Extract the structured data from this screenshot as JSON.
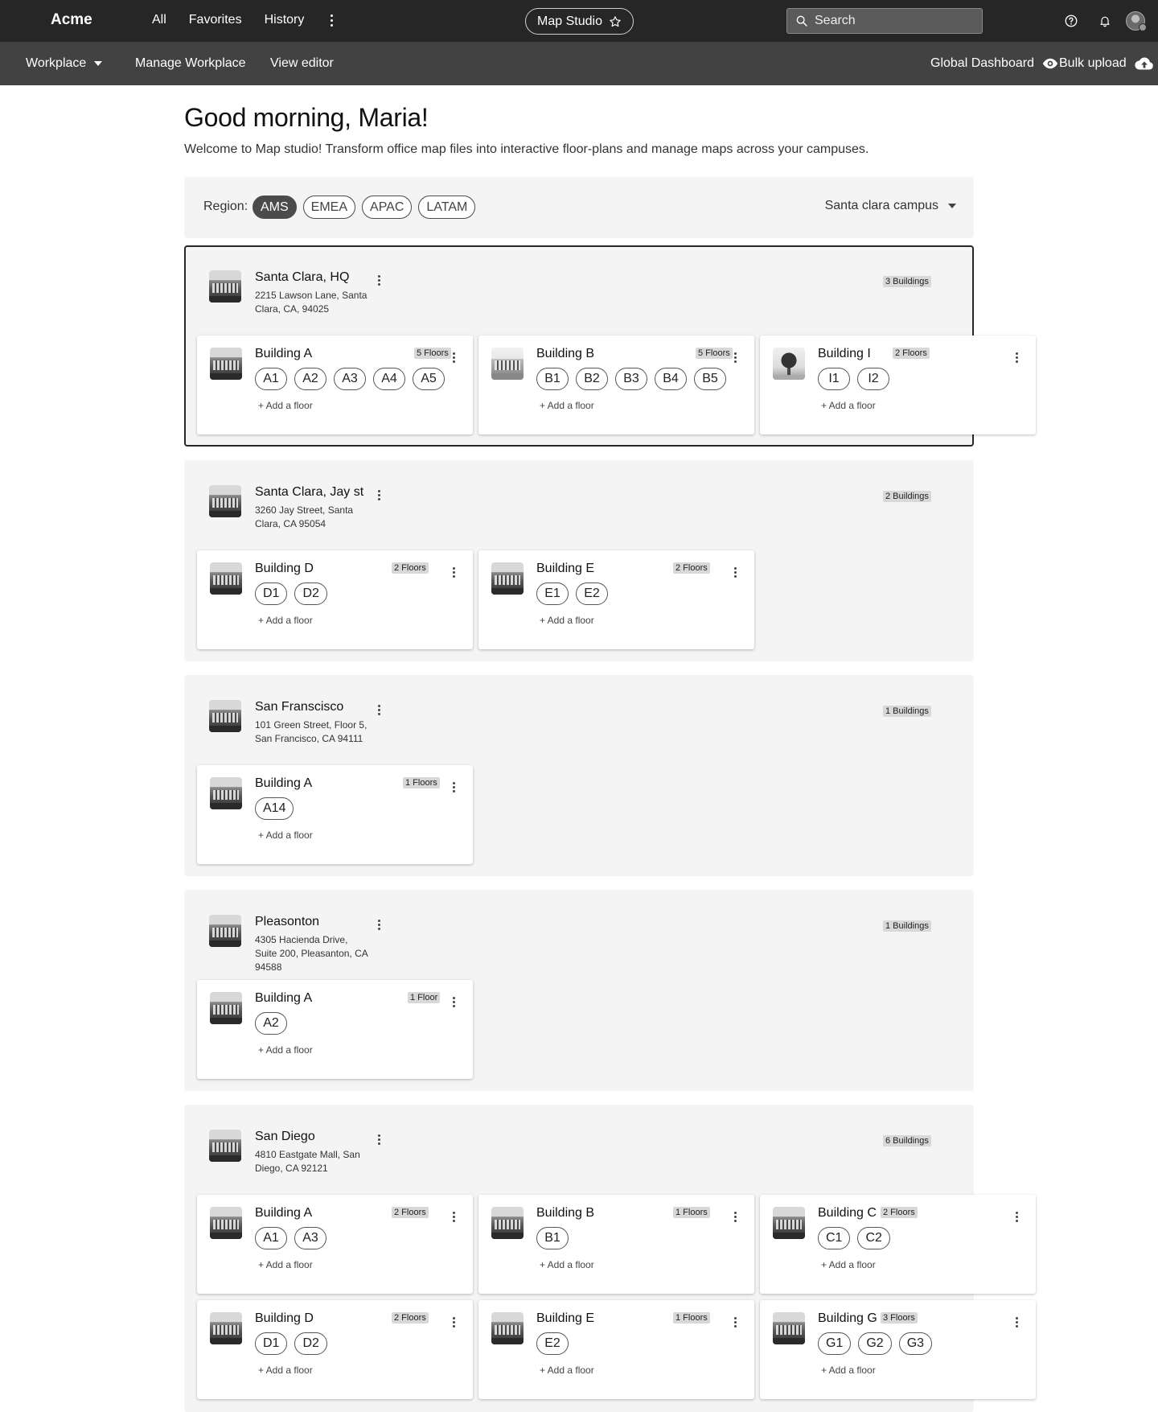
{
  "topbar": {
    "brand": "Acme",
    "nav": [
      "All",
      "Favorites",
      "History"
    ],
    "studio_label": "Map Studio",
    "search_placeholder": "Search"
  },
  "subbar": {
    "workplace": "Workplace",
    "manage": "Manage Workplace",
    "view_editor": "View editor",
    "global_dashboard": "Global Dashboard",
    "bulk_upload": "Bulk upload"
  },
  "header": {
    "greeting": "Good morning, Maria!",
    "welcome": "Welcome to Map studio! Transform office map files into interactive floor-plans and manage maps across your campuses."
  },
  "filter": {
    "label": "Region:",
    "regions": [
      "AMS",
      "EMEA",
      "APAC",
      "LATAM"
    ],
    "active_region": "AMS",
    "campus_select": "Santa clara campus"
  },
  "add_floor_label": "+ Add a floor",
  "campuses": [
    {
      "name": "Santa Clara, HQ",
      "address": "2215 Lawson Lane, Santa Clara, CA, 94025",
      "buildings_count": "3 Buildings",
      "buildings": [
        {
          "name": "Building A",
          "floors_label": "5 Floors",
          "floors": [
            "A1",
            "A2",
            "A3",
            "A4",
            "A5"
          ]
        },
        {
          "name": "Building B",
          "floors_label": "5 Floors",
          "floors": [
            "B1",
            "B2",
            "B3",
            "B4",
            "B5"
          ]
        },
        {
          "name": "Building I",
          "floors_label": "2 Floors",
          "floors": [
            "I1",
            "I2"
          ]
        }
      ]
    },
    {
      "name": "Santa Clara, Jay st",
      "address": "3260 Jay Street, Santa Clara, CA 95054",
      "buildings_count": "2 Buildings",
      "buildings": [
        {
          "name": "Building D",
          "floors_label": "2 Floors",
          "floors": [
            "D1",
            "D2"
          ]
        },
        {
          "name": "Building E",
          "floors_label": "2 Floors",
          "floors": [
            "E1",
            "E2"
          ]
        }
      ]
    },
    {
      "name": "San Franscisco",
      "address": "101 Green Street, Floor 5, San Francisco, CA 94111",
      "buildings_count": "1 Buildings",
      "buildings": [
        {
          "name": "Building A",
          "floors_label": "1 Floors",
          "floors": [
            "A14"
          ]
        }
      ]
    },
    {
      "name": "Pleasonton",
      "address": "4305 Hacienda Drive, Suite 200, Pleasanton, CA 94588",
      "buildings_count": "1 Buildings",
      "buildings": [
        {
          "name": "Building A",
          "floors_label": "1 Floor",
          "floors": [
            "A2"
          ]
        }
      ]
    },
    {
      "name": "San Diego",
      "address": "4810 Eastgate Mall, San Diego, CA 92121",
      "buildings_count": "6 Buildings",
      "buildings": [
        {
          "name": "Building A",
          "floors_label": "2 Floors",
          "floors": [
            "A1",
            "A3"
          ]
        },
        {
          "name": "Building B",
          "floors_label": "1 Floors",
          "floors": [
            "B1"
          ]
        },
        {
          "name": "Building C",
          "floors_label": "2 Floors",
          "floors": [
            "C1",
            "C2"
          ]
        },
        {
          "name": "Building D",
          "floors_label": "2 Floors",
          "floors": [
            "D1",
            "D2"
          ]
        },
        {
          "name": "Building E",
          "floors_label": "1 Floors",
          "floors": [
            "E2"
          ]
        },
        {
          "name": "Building G",
          "floors_label": "3 Floors",
          "floors": [
            "G1",
            "G2",
            "G3"
          ]
        }
      ]
    }
  ]
}
